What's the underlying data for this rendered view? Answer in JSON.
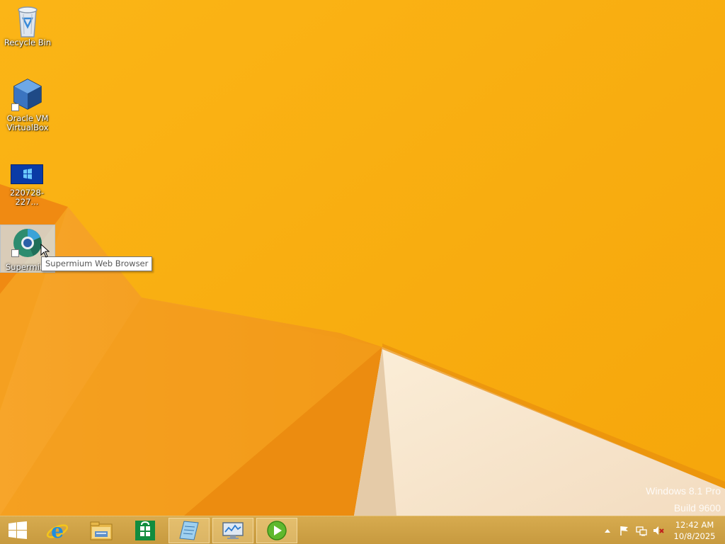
{
  "desktop": {
    "icons": [
      {
        "label": "Recycle Bin",
        "icon": "recycle-bin-icon"
      },
      {
        "label": "Oracle VM VirtualBox",
        "icon": "virtualbox-icon"
      },
      {
        "label": "220728-227...",
        "icon": "windows-image-icon"
      },
      {
        "label": "Supermium",
        "icon": "supermium-icon"
      }
    ],
    "tooltip": "Supermium Web Browser",
    "watermark": {
      "line1": "Windows 8.1 Pro",
      "line2": "Build 9600"
    }
  },
  "taskbar": {
    "buttons": [
      {
        "name": "start",
        "icon": "windows-logo-icon"
      },
      {
        "name": "internet-explorer",
        "icon": "internet-explorer-icon"
      },
      {
        "name": "file-explorer",
        "icon": "file-explorer-icon"
      },
      {
        "name": "store",
        "icon": "store-icon"
      },
      {
        "name": "app-notepad",
        "icon": "notepad-icon"
      },
      {
        "name": "app-monitor",
        "icon": "resource-monitor-icon"
      },
      {
        "name": "app-player",
        "icon": "media-player-icon"
      }
    ],
    "tray": {
      "icons": [
        "show-hidden-icons-icon",
        "action-center-flag-icon",
        "network-icon",
        "volume-muted-icon"
      ],
      "time": "12:42 AM",
      "date": "10/8/2025"
    }
  },
  "colors": {
    "wallpaper": "#f8ad0f",
    "taskbar": "#cfa347",
    "tooltip_border": "#767676"
  }
}
